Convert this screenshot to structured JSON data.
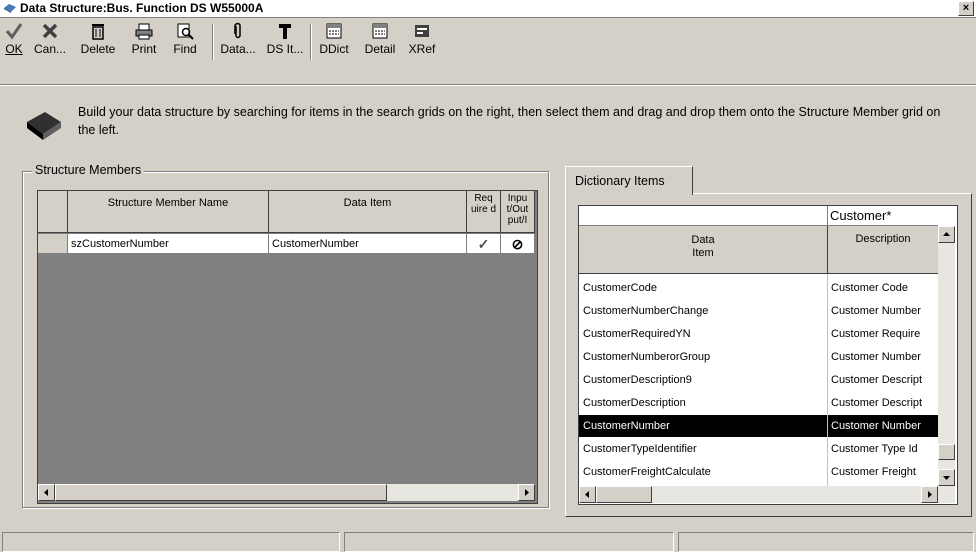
{
  "window": {
    "title": "Data Structure:Bus. Function DS W55000A",
    "close": "×"
  },
  "toolbar": {
    "ok": "OK",
    "cancel": "Can...",
    "delete": "Delete",
    "print": "Print",
    "find": "Find",
    "data": "Data...",
    "ds_item": "DS It...",
    "ddict": "DDict",
    "detail": "Detail",
    "xref": "XRef"
  },
  "info": {
    "text": "Build your data structure by searching for items in the search grids on the right, then select them and drag and drop them onto the Structure Member grid on the left."
  },
  "structure": {
    "group_label": "Structure Members",
    "headers": {
      "member": "Structure Member Name",
      "item": "Data Item",
      "req": "Req uire d",
      "io": "Inpu t/Out put/I"
    },
    "rows": [
      {
        "member": "szCustomerNumber",
        "item": "CustomerNumber",
        "required": "✓",
        "io": "⊘"
      }
    ]
  },
  "dictionary": {
    "tab_label": "Dictionary Items",
    "filter_item": "",
    "filter_desc": "Customer*",
    "headers": {
      "item": "Data Item",
      "desc": "Description"
    },
    "rows": [
      {
        "item": "CustomerCode",
        "desc": "Customer Code"
      },
      {
        "item": "CustomerNumberChange",
        "desc": "Customer Number"
      },
      {
        "item": "CustomerRequiredYN",
        "desc": "Customer Require"
      },
      {
        "item": "CustomerNumberorGroup",
        "desc": "Customer Number"
      },
      {
        "item": "CustomerDescription9",
        "desc": "Customer Descript"
      },
      {
        "item": "CustomerDescription",
        "desc": "Customer Descript"
      },
      {
        "item": "CustomerNumber",
        "desc": "Customer Number"
      },
      {
        "item": "CustomerTypeIdentifier",
        "desc": "Customer Type Id"
      },
      {
        "item": "CustomerFreightCalculate",
        "desc": "Customer Freight"
      }
    ],
    "selected_index": 6
  },
  "colors": {
    "selection": "#000000",
    "face": "#d4d0c8",
    "dark_panel": "#808080"
  }
}
